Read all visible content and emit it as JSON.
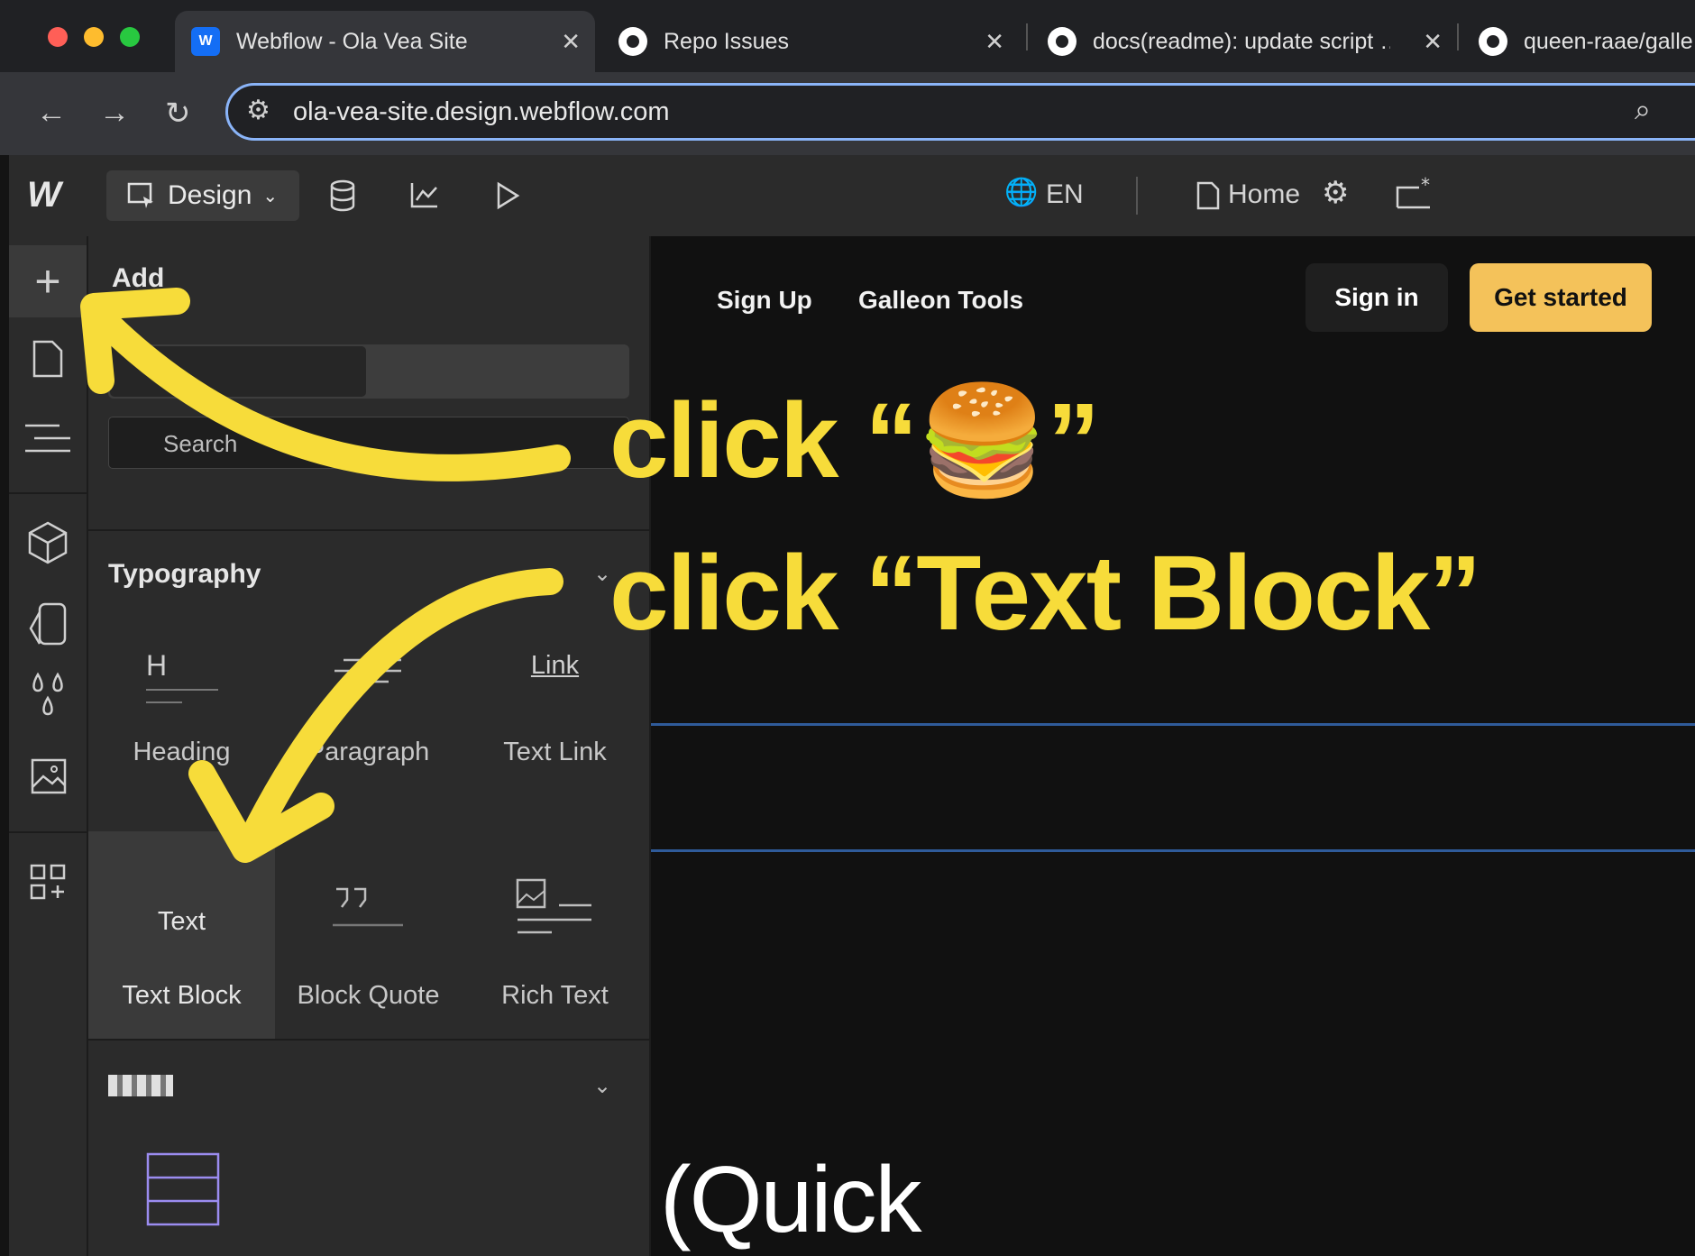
{
  "browser": {
    "tabs": [
      {
        "title": "Webflow - Ola Vea Site",
        "active": true
      },
      {
        "title": "Repo Issues",
        "active": false
      },
      {
        "title": "docs(readme): update script …",
        "active": false
      },
      {
        "title": "queen-raae/galle",
        "active": false
      }
    ],
    "url": "ola-vea-site.design.webflow.com"
  },
  "webflow": {
    "mode_label": "Design",
    "locale": "EN",
    "page": "Home",
    "panel": {
      "title": "Add",
      "search_placeholder": "Search",
      "sections": [
        {
          "title": "Typography",
          "items": [
            {
              "icon_text": "H",
              "label": "Heading"
            },
            {
              "icon_text": "",
              "label": "Paragraph"
            },
            {
              "icon_text": "Link",
              "label": "Text Link"
            },
            {
              "icon_text": "Text",
              "label": "Text Block"
            },
            {
              "icon_text": "",
              "label": "Block Quote"
            },
            {
              "icon_text": "",
              "label": "Rich Text"
            }
          ]
        }
      ]
    }
  },
  "site_preview": {
    "nav_links": [
      "Sign Up",
      "Galleon Tools"
    ],
    "sign_in": "Sign in",
    "get_started": "Get started",
    "bottom_text": "(Quick"
  },
  "annotation": {
    "line1": "click “🍔”",
    "line2": "click “Text Block”",
    "color": "#f7dc3a"
  },
  "colors": {
    "accent_blue": "#8ab4f8",
    "cta_yellow": "#f4c25a",
    "webflow_blue": "#146ef5"
  }
}
